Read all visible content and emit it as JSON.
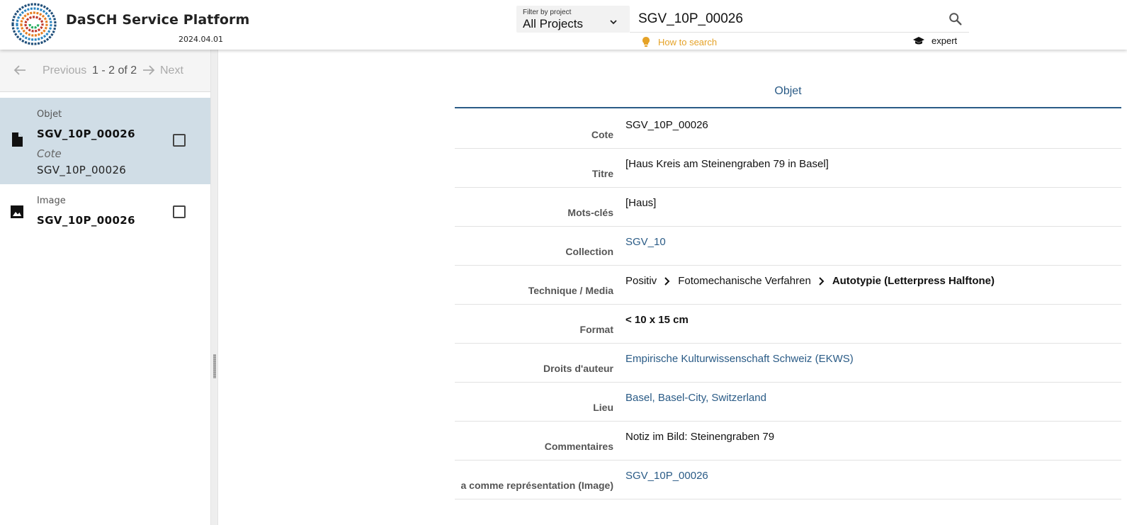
{
  "header": {
    "title": "DaSCH Service Platform",
    "version": "2024.04.01",
    "filter": {
      "label": "Filter by project",
      "value": "All Projects"
    },
    "search": {
      "value": "SGV_10P_00026"
    },
    "how_to_search": "How to search",
    "expert": "expert",
    "colors": {
      "accent": "#e5a227",
      "link": "#2a5b86"
    }
  },
  "sidebar": {
    "pager": {
      "previous": "Previous",
      "range": "1 - 2 of 2",
      "next": "Next"
    },
    "results": [
      {
        "type": "Objet",
        "label": "SGV_10P_00026",
        "prop_name": "Cote",
        "prop_value": "SGV_10P_00026",
        "icon": "document-icon",
        "selected": true
      },
      {
        "type": "Image",
        "label": "SGV_10P_00026",
        "icon": "image-icon",
        "selected": false
      }
    ]
  },
  "main": {
    "tab": "Objet",
    "properties": [
      {
        "label": "Cote",
        "value": "SGV_10P_00026"
      },
      {
        "label": "Titre",
        "value": "[Haus Kreis am Steinengraben 79 in Basel]"
      },
      {
        "label": "Mots-clés",
        "value": "[Haus]"
      },
      {
        "label": "Collection",
        "value": "SGV_10"
      },
      {
        "label": "Technique / Media",
        "crumbs": [
          "Positiv",
          "Fotomechanische Verfahren",
          "Autotypie (Letterpress Halftone)"
        ]
      },
      {
        "label": "Format",
        "value": "< 10 x 15 cm"
      },
      {
        "label": "Droits d'auteur",
        "value": "Empirische Kulturwissenschaft Schweiz (EKWS)"
      },
      {
        "label": "Lieu",
        "value": "Basel, Basel-City, Switzerland"
      },
      {
        "label": "Commentaires",
        "value": "Notiz im Bild: Steinengraben 79"
      },
      {
        "label": "a comme représentation (Image)",
        "value": "SGV_10P_00026"
      }
    ]
  }
}
